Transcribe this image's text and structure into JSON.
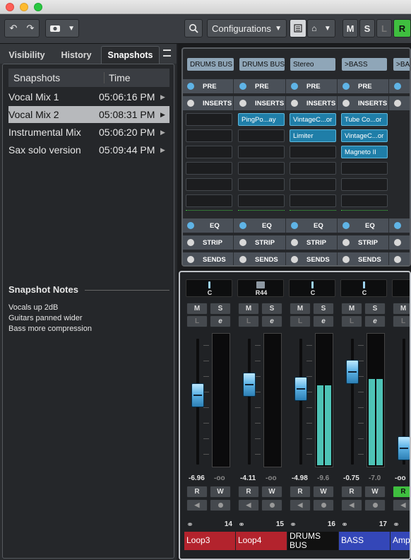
{
  "toolbar": {
    "configurations": "Configurations",
    "m": "M",
    "s": "S",
    "l": "L",
    "r": "R"
  },
  "tabs": [
    "Visibility",
    "History",
    "Snapshots"
  ],
  "snapshots": {
    "col_name": "Snapshots",
    "col_time": "Time",
    "rows": [
      {
        "name": "Vocal Mix 1",
        "time": "05:06:16 PM"
      },
      {
        "name": "Vocal Mix 2",
        "time": "05:08:31 PM"
      },
      {
        "name": "Instrumental Mix",
        "time": "05:06:20 PM"
      },
      {
        "name": "Sax solo version",
        "time": "05:09:44 PM"
      }
    ]
  },
  "notes": {
    "title": "Snapshot Notes",
    "lines": [
      "Vocals up 2dB",
      "Guitars panned wider",
      "Bass more compression"
    ]
  },
  "routing": [
    "DRUMS BUS",
    "DRUMS BUS",
    "Stereo",
    ">BASS",
    ">BAS"
  ],
  "sections": {
    "pre": "PRE",
    "inserts": "INSERTS",
    "eq": "EQ",
    "strip": "STRIP",
    "sends": "SENDS"
  },
  "inserts": [
    [
      "",
      "",
      ""
    ],
    [
      "PingPo...ay",
      "",
      ""
    ],
    [
      "VintageC...or",
      "Limiter",
      ""
    ],
    [
      "Tube Co...or",
      "VintageC...or",
      "Magneto II"
    ]
  ],
  "channels": [
    {
      "pan": "C",
      "fader": "-6.96",
      "peak": "-oo",
      "num": "14",
      "name": "Loop3",
      "color": "#b3232d",
      "level": 0,
      "fpos": 0.42
    },
    {
      "pan": "R44",
      "fader": "-4.11",
      "peak": "-oo",
      "num": "15",
      "name": "Loop4",
      "color": "#b3232d",
      "level": 0,
      "fpos": 0.32
    },
    {
      "pan": "C",
      "fader": "-4.98",
      "peak": "-9.6",
      "num": "16",
      "name": "DRUMS BUS",
      "color": "#111111",
      "level": 0.63,
      "fpos": 0.36
    },
    {
      "pan": "C",
      "fader": "-0.75",
      "peak": "-7.0",
      "num": "17",
      "name": "BASS",
      "color": "#3447b8",
      "level": 0.68,
      "fpos": 0.2
    },
    {
      "pan": "",
      "fader": "-oo",
      "peak": "",
      "num": "",
      "name": "Amp Peda",
      "color": "#3447b8",
      "level": 0,
      "fpos": 0.92
    }
  ],
  "btn": {
    "m": "M",
    "s": "S",
    "l": "L",
    "e": "e",
    "r": "R",
    "w": "W"
  },
  "colors": {
    "accent": "#5fb4e6",
    "active": "#1f7ea8",
    "meter": "#4ec3b6",
    "record": "#3fbf3f"
  }
}
